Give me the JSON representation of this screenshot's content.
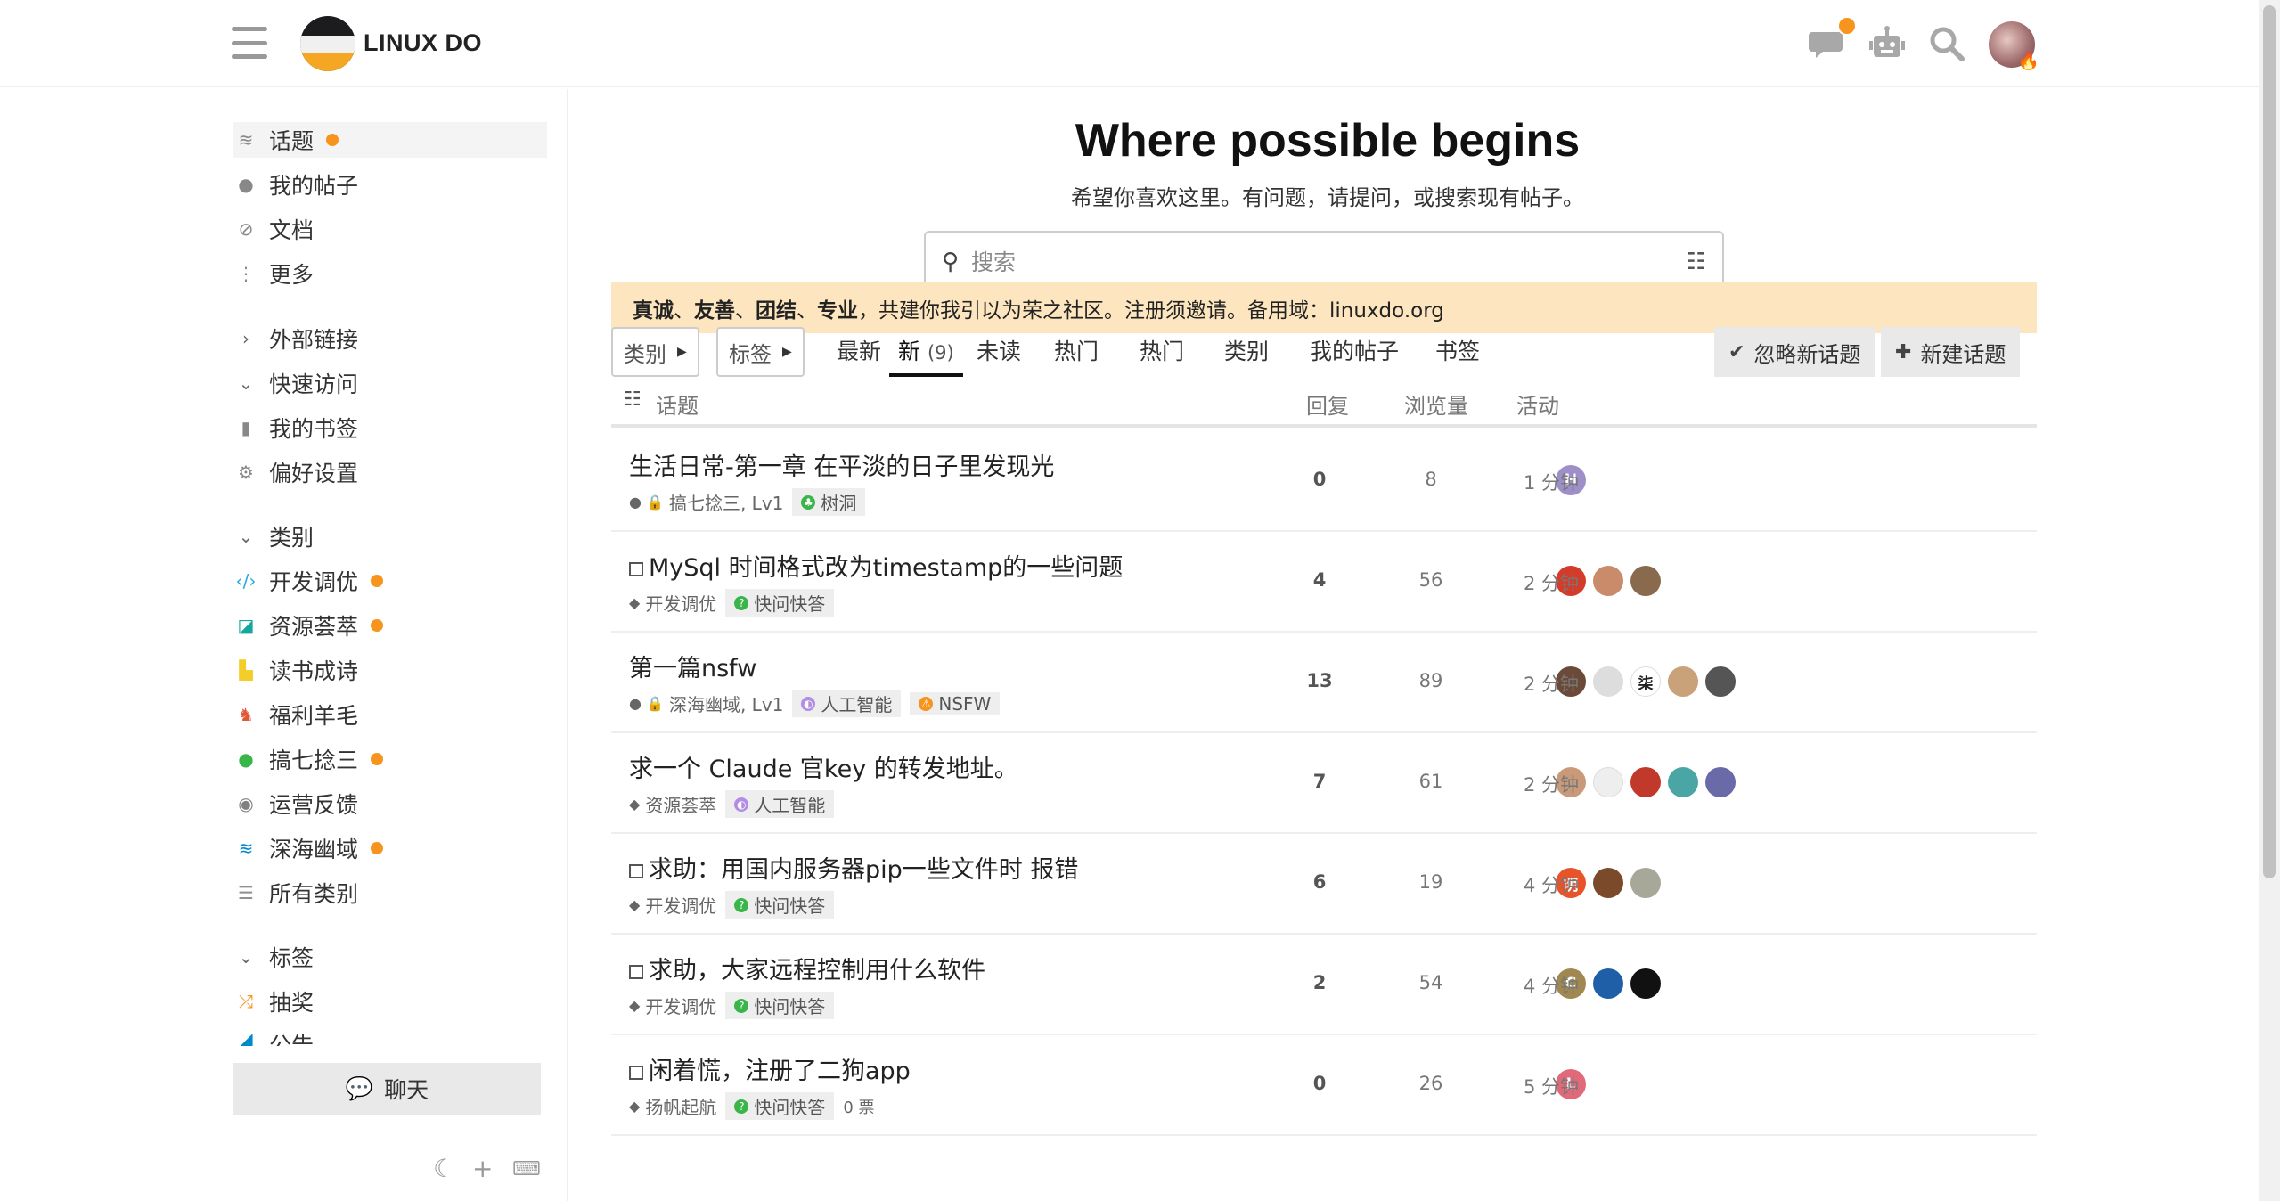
{
  "header": {
    "brand": "LINUX DO",
    "icons": [
      "hamburger-icon",
      "chat-icon",
      "robot-icon",
      "search-icon",
      "user-avatar"
    ]
  },
  "sidebar": {
    "primary": [
      {
        "label": "话题",
        "icon": "layers-icon",
        "dot": true
      },
      {
        "label": "我的帖子",
        "icon": "user-icon",
        "dot": false
      },
      {
        "label": "文档",
        "icon": "link-icon",
        "dot": false
      },
      {
        "label": "更多",
        "icon": "more-icon",
        "dot": false
      }
    ],
    "external_links": "外部链接",
    "quick_access": "快速访问",
    "quick_items": [
      {
        "label": "我的书签",
        "icon": "bookmark-icon"
      },
      {
        "label": "偏好设置",
        "icon": "gear-icon"
      }
    ],
    "categories_header": "类别",
    "categories": [
      {
        "label": "开发调优",
        "color": "#25aae1",
        "dot": true
      },
      {
        "label": "资源荟萃",
        "color": "#12a89d",
        "dot": true
      },
      {
        "label": "读书成诗",
        "color": "#f4ce28",
        "dot": false
      },
      {
        "label": "福利羊毛",
        "color": "#e45735",
        "dot": false
      },
      {
        "label": "搞七捻三",
        "color": "#3ab54a",
        "dot": true
      },
      {
        "label": "运营反馈",
        "color": "#808281",
        "dot": false
      },
      {
        "label": "深海幽域",
        "color": "#0088cc",
        "dot": true
      },
      {
        "label": "所有类别",
        "color": "#919191",
        "dot": false
      }
    ],
    "tags_header": "标签",
    "tags": [
      {
        "label": "抽奖",
        "color": "#f7941d"
      },
      {
        "label": "公告",
        "color": "#0088cc"
      }
    ],
    "chat_button": "聊天"
  },
  "main": {
    "hero_title": "Where possible begins",
    "hero_subtitle": "希望你喜欢这里。有问题，请提问，或搜索现有帖子。",
    "search_placeholder": "搜索",
    "banner": {
      "bold": [
        "真诚",
        "友善",
        "团结",
        "专业"
      ],
      "sep": "、",
      "rest": "，共建你我引以为荣之社区。注册须邀请。备用域：linuxdo.org"
    },
    "dropdowns": [
      "类别",
      "标签"
    ],
    "nav": [
      "最新",
      "新",
      "未读",
      "热门",
      "热门",
      "类别",
      "我的帖子",
      "书签"
    ],
    "new_count": "(9)",
    "buttons": {
      "dismiss": "忽略新话题",
      "new_topic": "新建话题"
    },
    "columns": {
      "topic": "话题",
      "replies": "回复",
      "views": "浏览量",
      "activity": "活动"
    },
    "topics": [
      {
        "title": "生活日常-第一章 在平淡的日子里发现光",
        "checkbox": false,
        "category": "搞七捻三, Lv1",
        "locked": true,
        "tags": [
          {
            "label": "树洞",
            "color": "#3ab54a",
            "shape": "tree"
          }
        ],
        "extra": "",
        "replies": "0",
        "views": "8",
        "activity": "1 分钟",
        "avatars": [
          {
            "bg": "#9e8fc8",
            "text": "H"
          }
        ]
      },
      {
        "title": "MySql 时间格式改为timestamp的一些问题",
        "checkbox": true,
        "category": "开发调优",
        "locked": false,
        "tags": [
          {
            "label": "快问快答",
            "color": "#3ab54a",
            "shape": "q"
          }
        ],
        "extra": "",
        "replies": "4",
        "views": "56",
        "activity": "2 分钟",
        "avatars": [
          {
            "bg": "#d33c2b",
            "text": ""
          },
          {
            "bg": "#c98b6a",
            "text": ""
          },
          {
            "bg": "#8a6a4c",
            "text": ""
          }
        ]
      },
      {
        "title": "第一篇nsfw",
        "checkbox": false,
        "category": "深海幽域, Lv1",
        "locked": true,
        "tags": [
          {
            "label": "人工智能",
            "color": "#b28de3",
            "shape": "brain"
          },
          {
            "label": "NSFW",
            "color": "#f7941d",
            "shape": "warn"
          }
        ],
        "extra": "",
        "replies": "13",
        "views": "89",
        "activity": "2 分钟",
        "avatars": [
          {
            "bg": "#6b4a3a",
            "text": ""
          },
          {
            "bg": "#dddddd",
            "text": ""
          },
          {
            "bg": "#ffffff",
            "text": "柒"
          },
          {
            "bg": "#c9a27a",
            "text": ""
          },
          {
            "bg": "#555555",
            "text": ""
          }
        ]
      },
      {
        "title": "求一个 Claude 官key 的转发地址。",
        "checkbox": false,
        "category": "资源荟萃",
        "locked": false,
        "tags": [
          {
            "label": "人工智能",
            "color": "#b28de3",
            "shape": "brain"
          }
        ],
        "extra": "",
        "replies": "7",
        "views": "61",
        "activity": "2 分钟",
        "avatars": [
          {
            "bg": "#c99a7a",
            "text": ""
          },
          {
            "bg": "#eeeeee",
            "text": ""
          },
          {
            "bg": "#c0392b",
            "text": ""
          },
          {
            "bg": "#4aa5a5",
            "text": ""
          },
          {
            "bg": "#6a6aa8",
            "text": ""
          }
        ]
      },
      {
        "title": "求助：用国内服务器pip一些文件时 报错",
        "checkbox": true,
        "category": "开发调优",
        "locked": false,
        "tags": [
          {
            "label": "快问快答",
            "color": "#3ab54a",
            "shape": "q"
          }
        ],
        "extra": "",
        "replies": "6",
        "views": "19",
        "activity": "4 分钟",
        "avatars": [
          {
            "bg": "#e8532a",
            "text": "明"
          },
          {
            "bg": "#7a4a2a",
            "text": ""
          },
          {
            "bg": "#a8a89a",
            "text": ""
          }
        ]
      },
      {
        "title": "求助，大家远程控制用什么软件",
        "checkbox": true,
        "category": "开发调优",
        "locked": false,
        "tags": [
          {
            "label": "快问快答",
            "color": "#3ab54a",
            "shape": "q"
          }
        ],
        "extra": "",
        "replies": "2",
        "views": "54",
        "activity": "4 分钟",
        "avatars": [
          {
            "bg": "#a08850",
            "text": "C"
          },
          {
            "bg": "#1f5fa8",
            "text": ""
          },
          {
            "bg": "#111111",
            "text": ""
          }
        ]
      },
      {
        "title": "闲着慌，注册了二狗app",
        "checkbox": true,
        "category": "扬帆起航",
        "locked": false,
        "tags": [
          {
            "label": "快问快答",
            "color": "#3ab54a",
            "shape": "q"
          }
        ],
        "extra": "0 票",
        "replies": "0",
        "views": "26",
        "activity": "5 分钟",
        "avatars": [
          {
            "bg": "#e06a7a",
            "text": "L"
          }
        ]
      }
    ]
  }
}
